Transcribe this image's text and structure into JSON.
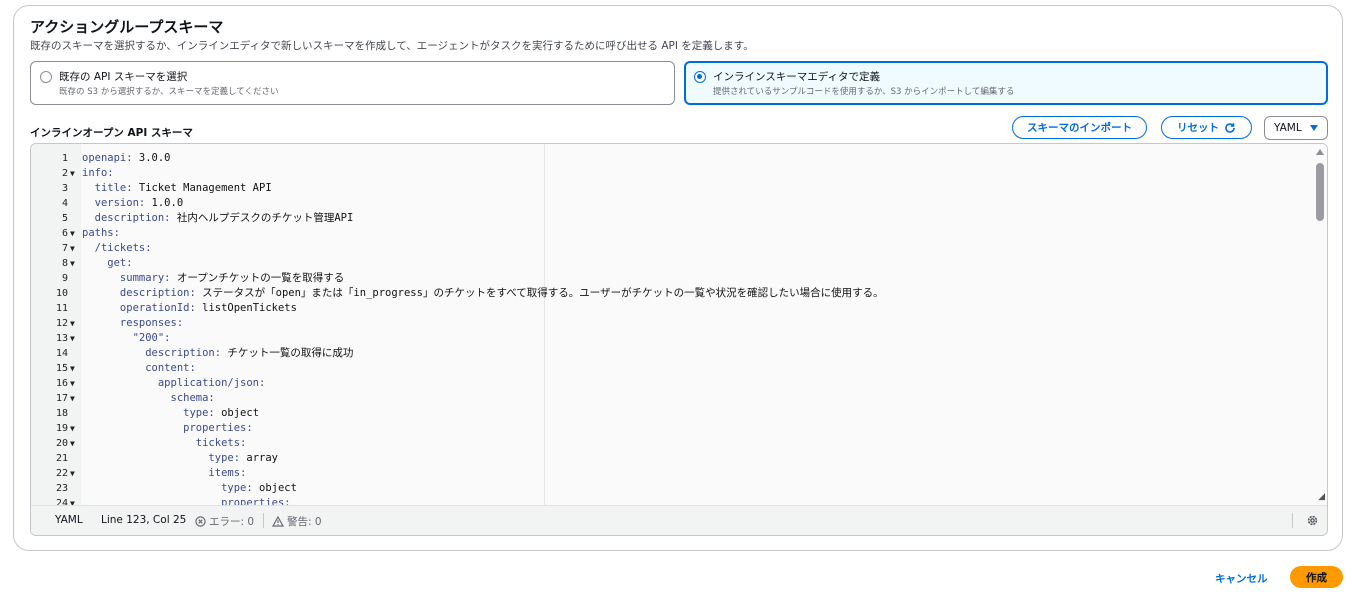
{
  "header": {
    "title": "アクショングループスキーマ",
    "subtitle": "既存のスキーマを選択するか、インラインエディタで新しいスキーマを作成して、エージェントがタスクを実行するために呼び出せる API を定義します。"
  },
  "options": {
    "existing": {
      "title": "既存の API スキーマを選択",
      "description": "既存の S3 から選択するか、スキーマを定義してください",
      "selected": false
    },
    "inline": {
      "title": "インラインスキーマエディタで定義",
      "description": "提供されているサンプルコードを使用するか、S3 からインポートして編集する",
      "selected": true
    }
  },
  "editor": {
    "label": "インラインオープン API スキーマ",
    "import_button": "スキーマのインポート",
    "reset_button": "リセット",
    "format_select": "YAML",
    "lines": [
      {
        "n": "1",
        "fold": "",
        "key": "openapi:",
        "val": " 3.0.0"
      },
      {
        "n": "2",
        "fold": "▼",
        "key": "info:",
        "val": ""
      },
      {
        "n": "3",
        "fold": "",
        "key": "  title:",
        "val": " Ticket Management API"
      },
      {
        "n": "4",
        "fold": "",
        "key": "  version:",
        "val": " 1.0.0"
      },
      {
        "n": "5",
        "fold": "",
        "key": "  description:",
        "val": " 社内ヘルプデスクのチケット管理API"
      },
      {
        "n": "6",
        "fold": "▼",
        "key": "paths:",
        "val": ""
      },
      {
        "n": "7",
        "fold": "▼",
        "key": "  /tickets:",
        "val": ""
      },
      {
        "n": "8",
        "fold": "▼",
        "key": "    get:",
        "val": ""
      },
      {
        "n": "9",
        "fold": "",
        "key": "      summary:",
        "val": " オープンチケットの一覧を取得する"
      },
      {
        "n": "10",
        "fold": "",
        "key": "      description:",
        "val": " ステータスが「open」または「in_progress」のチケットをすべて取得する。ユーザーがチケットの一覧や状況を確認したい場合に使用する。"
      },
      {
        "n": "11",
        "fold": "",
        "key": "      operationId:",
        "val": " listOpenTickets"
      },
      {
        "n": "12",
        "fold": "▼",
        "key": "      responses:",
        "val": ""
      },
      {
        "n": "13",
        "fold": "▼",
        "key": "        \"200\":",
        "val": ""
      },
      {
        "n": "14",
        "fold": "",
        "key": "          description:",
        "val": " チケット一覧の取得に成功"
      },
      {
        "n": "15",
        "fold": "▼",
        "key": "          content:",
        "val": ""
      },
      {
        "n": "16",
        "fold": "▼",
        "key": "            application/json:",
        "val": ""
      },
      {
        "n": "17",
        "fold": "▼",
        "key": "              schema:",
        "val": ""
      },
      {
        "n": "18",
        "fold": "",
        "key": "                type:",
        "val": " object"
      },
      {
        "n": "19",
        "fold": "▼",
        "key": "                properties:",
        "val": ""
      },
      {
        "n": "20",
        "fold": "▼",
        "key": "                  tickets:",
        "val": ""
      },
      {
        "n": "21",
        "fold": "",
        "key": "                    type:",
        "val": " array"
      },
      {
        "n": "22",
        "fold": "▼",
        "key": "                    items:",
        "val": ""
      },
      {
        "n": "23",
        "fold": "",
        "key": "                      type:",
        "val": " object"
      },
      {
        "n": "24",
        "fold": "▼",
        "key": "                      properties:",
        "val": ""
      }
    ]
  },
  "status": {
    "mode": "YAML",
    "position": "Line 123, Col 25",
    "errors": "エラー: 0",
    "warnings": "警告: 0"
  },
  "footer": {
    "cancel": "キャンセル",
    "create": "作成"
  },
  "colors": {
    "accent": "#006ce0",
    "primary_button": "#ff9900"
  }
}
